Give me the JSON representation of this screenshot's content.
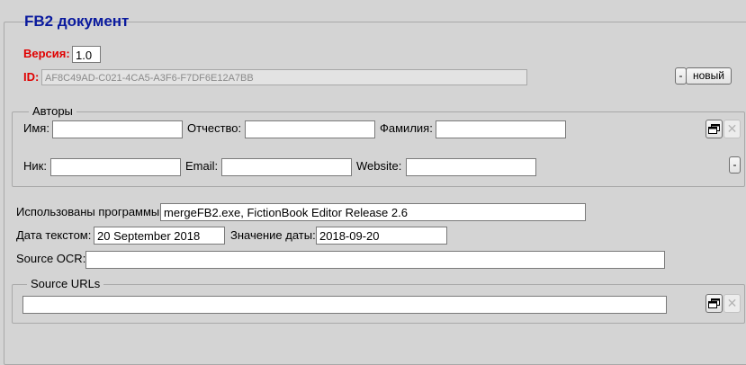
{
  "section": {
    "title": "FB2 документ"
  },
  "version": {
    "label": "Версия:",
    "value": "1.0"
  },
  "id": {
    "label": "ID:",
    "value": "AF8C49AD-C021-4CA5-A3F6-F7DF6E12A7BB",
    "minus": "-",
    "new_label": "новый"
  },
  "authors": {
    "legend": "Авторы",
    "first_name_label": "Имя:",
    "first_name": "",
    "middle_name_label": "Отчество:",
    "middle_name": "",
    "last_name_label": "Фамилия:",
    "last_name": "",
    "nick_label": "Ник:",
    "nick": "",
    "email_label": "Email:",
    "email": "",
    "website_label": "Website:",
    "website": "",
    "add_icon": "window-icon",
    "remove_icon": "x-icon",
    "minus": "-"
  },
  "programs": {
    "label": "Использованы программы:",
    "value": "mergeFB2.exe, FictionBook Editor Release 2.6"
  },
  "date_text": {
    "label": "Дата текстом:",
    "value": "20 September 2018"
  },
  "date_value": {
    "label": "Значение даты:",
    "value": "2018-09-20"
  },
  "source_ocr": {
    "label": "Source OCR:",
    "value": ""
  },
  "source_urls": {
    "legend": "Source URLs",
    "value": "",
    "add_icon": "window-icon",
    "remove_icon": "x-icon"
  },
  "colors": {
    "title": "#0a1a9e",
    "required_label": "#e00000",
    "background": "#d4d4d4"
  }
}
